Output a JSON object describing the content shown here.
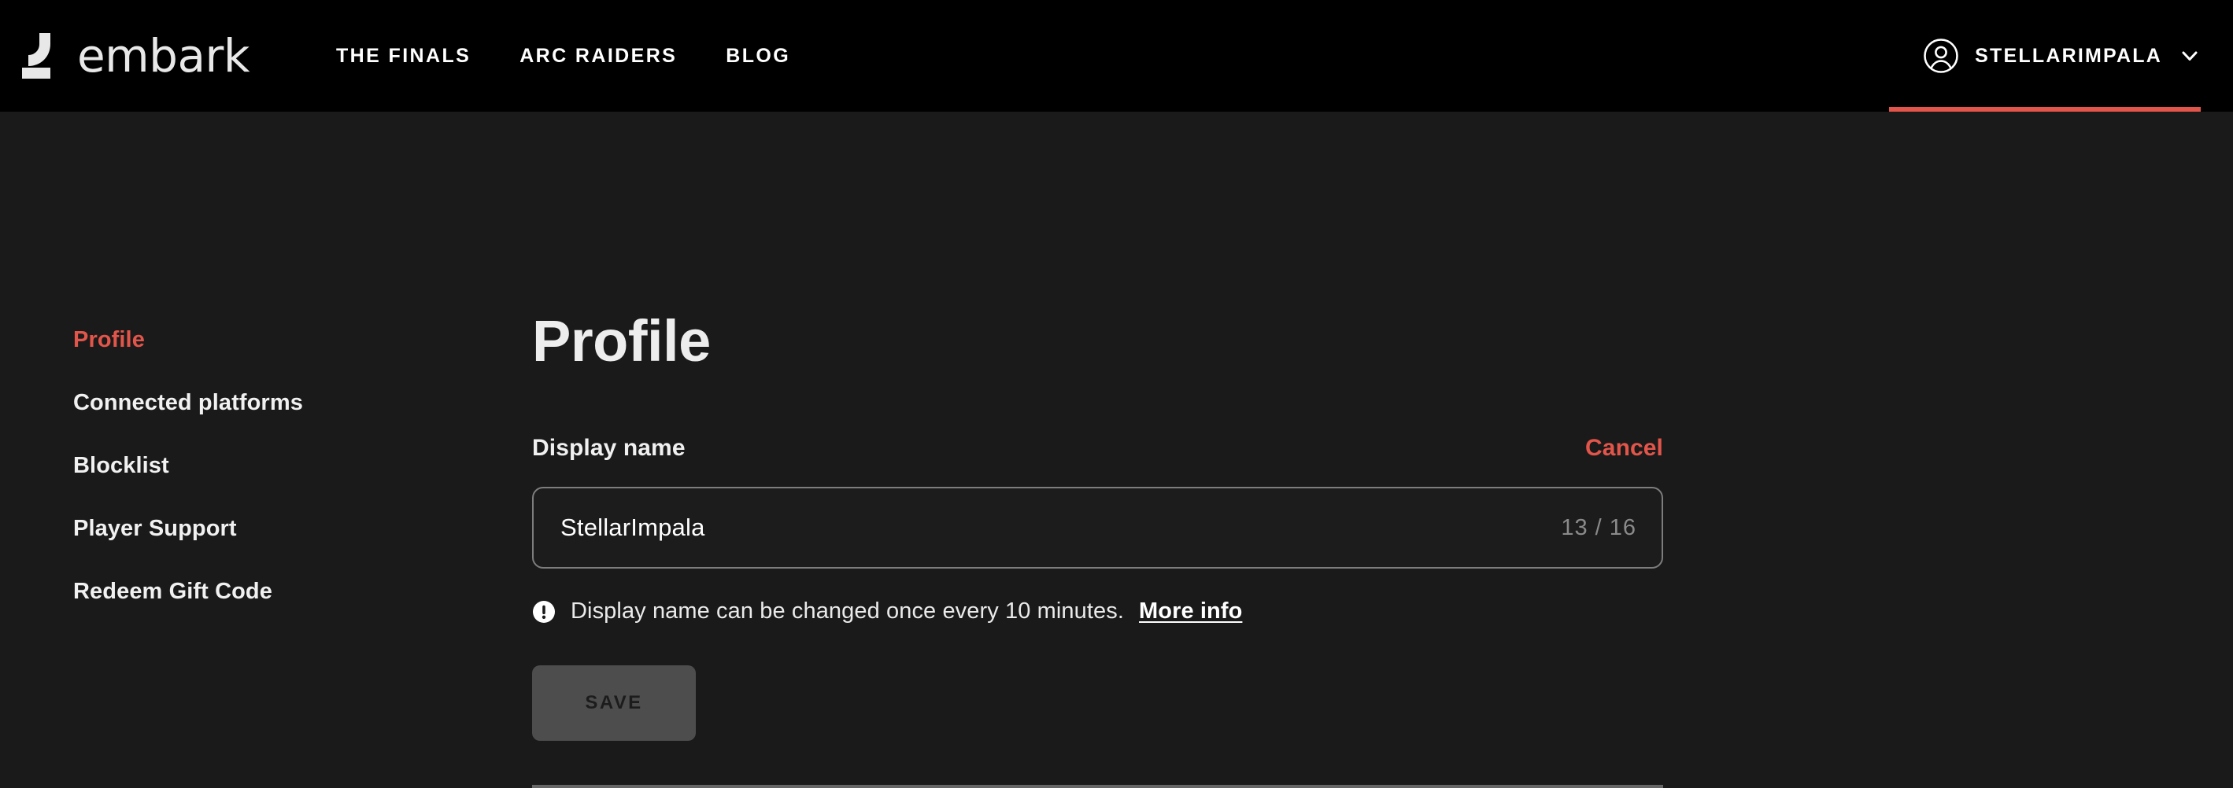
{
  "theme": {
    "header_bg": "#000000",
    "page_bg": "#1a1a1a",
    "accent": "#e2554a",
    "text": "#f0f0f0",
    "muted": "#8a8a8a",
    "input_border": "#7d7d7d",
    "button_disabled_bg": "#4d4d4d",
    "divider": "#666666"
  },
  "header": {
    "brand": {
      "wordmark": "embark",
      "logo_icon": "embark-hook-logo"
    },
    "nav": [
      {
        "label": "THE FINALS"
      },
      {
        "label": "ARC RAIDERS"
      },
      {
        "label": "BLOG"
      }
    ],
    "account": {
      "avatar_icon": "user-circle-icon",
      "username": "STELLARIMPALA",
      "chevron_icon": "chevron-down-icon"
    }
  },
  "sidebar": {
    "items": [
      {
        "label": "Profile",
        "active": true
      },
      {
        "label": "Connected platforms",
        "active": false
      },
      {
        "label": "Blocklist",
        "active": false
      },
      {
        "label": "Player Support",
        "active": false
      },
      {
        "label": "Redeem Gift Code",
        "active": false
      }
    ]
  },
  "main": {
    "title": "Profile",
    "display_name": {
      "label": "Display name",
      "cancel_label": "Cancel",
      "value": "StellarImpala",
      "placeholder": "Display name",
      "counter": "13 / 16",
      "current_length": 13,
      "max_length": 16
    },
    "note": {
      "icon": "exclamation-circle-icon",
      "text": "Display name can be changed once every 10 minutes.",
      "link_label": "More info"
    },
    "save_label": "SAVE"
  }
}
